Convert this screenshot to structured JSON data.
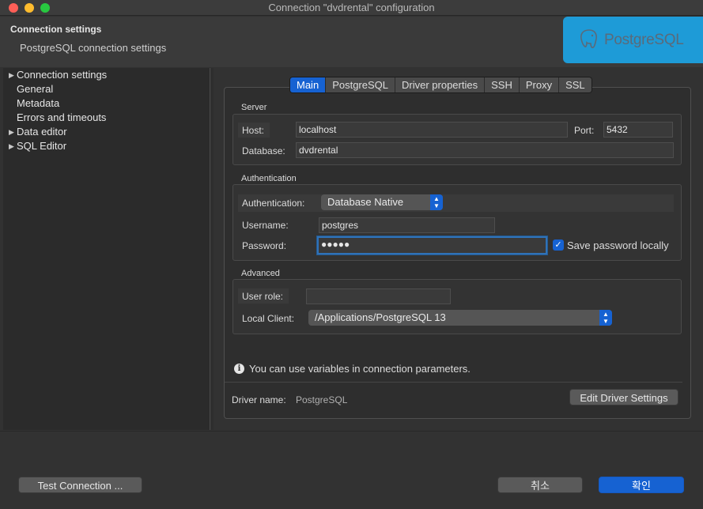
{
  "window": {
    "title": "Connection \"dvdrental\" configuration"
  },
  "header": {
    "title": "Connection settings",
    "subtitle": "PostgreSQL connection settings",
    "logo_text": "PostgreSQL"
  },
  "sidebar": {
    "items": [
      {
        "label": "Connection settings",
        "expandable": true
      },
      {
        "label": "General",
        "expandable": false
      },
      {
        "label": "Metadata",
        "expandable": false
      },
      {
        "label": "Errors and timeouts",
        "expandable": false
      },
      {
        "label": "Data editor",
        "expandable": true
      },
      {
        "label": "SQL Editor",
        "expandable": true
      }
    ]
  },
  "tabs": [
    {
      "label": "Main",
      "active": true
    },
    {
      "label": "PostgreSQL",
      "active": false
    },
    {
      "label": "Driver properties",
      "active": false
    },
    {
      "label": "SSH",
      "active": false
    },
    {
      "label": "Proxy",
      "active": false
    },
    {
      "label": "SSL",
      "active": false
    }
  ],
  "server": {
    "group_title": "Server",
    "host_label": "Host:",
    "host_value": "localhost",
    "port_label": "Port:",
    "port_value": "5432",
    "database_label": "Database:",
    "database_value": "dvdrental"
  },
  "auth": {
    "group_title": "Authentication",
    "auth_label": "Authentication:",
    "auth_value": "Database Native",
    "username_label": "Username:",
    "username_value": "postgres",
    "password_label": "Password:",
    "password_value": "●●●●●",
    "save_password_label": "Save password locally",
    "save_password_checked": true
  },
  "advanced": {
    "group_title": "Advanced",
    "user_role_label": "User role:",
    "user_role_value": "",
    "local_client_label": "Local Client:",
    "local_client_value": "/Applications/PostgreSQL 13"
  },
  "info": {
    "text": "You can use variables in connection parameters."
  },
  "driver": {
    "label": "Driver name:",
    "value": "PostgreSQL",
    "edit_button": "Edit Driver Settings"
  },
  "footer": {
    "test_button": "Test Connection ...",
    "cancel_button": "취소",
    "ok_button": "확인"
  },
  "colors": {
    "accent": "#1662d2",
    "logo_bg": "#1e9bd7",
    "background": "#323232"
  }
}
